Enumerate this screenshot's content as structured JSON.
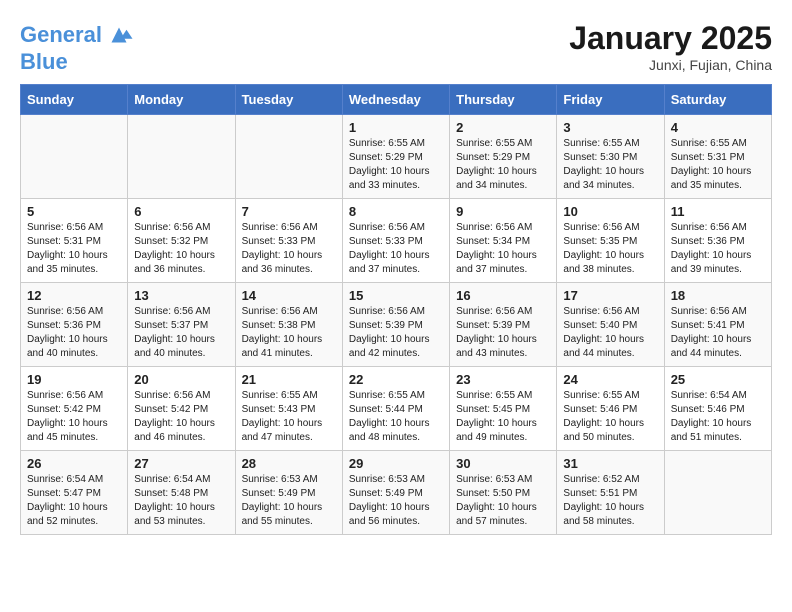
{
  "header": {
    "logo_line1": "General",
    "logo_line2": "Blue",
    "month": "January 2025",
    "location": "Junxi, Fujian, China"
  },
  "days_of_week": [
    "Sunday",
    "Monday",
    "Tuesday",
    "Wednesday",
    "Thursday",
    "Friday",
    "Saturday"
  ],
  "weeks": [
    [
      {
        "day": "",
        "info": ""
      },
      {
        "day": "",
        "info": ""
      },
      {
        "day": "",
        "info": ""
      },
      {
        "day": "1",
        "info": "Sunrise: 6:55 AM\nSunset: 5:29 PM\nDaylight: 10 hours\nand 33 minutes."
      },
      {
        "day": "2",
        "info": "Sunrise: 6:55 AM\nSunset: 5:29 PM\nDaylight: 10 hours\nand 34 minutes."
      },
      {
        "day": "3",
        "info": "Sunrise: 6:55 AM\nSunset: 5:30 PM\nDaylight: 10 hours\nand 34 minutes."
      },
      {
        "day": "4",
        "info": "Sunrise: 6:55 AM\nSunset: 5:31 PM\nDaylight: 10 hours\nand 35 minutes."
      }
    ],
    [
      {
        "day": "5",
        "info": "Sunrise: 6:56 AM\nSunset: 5:31 PM\nDaylight: 10 hours\nand 35 minutes."
      },
      {
        "day": "6",
        "info": "Sunrise: 6:56 AM\nSunset: 5:32 PM\nDaylight: 10 hours\nand 36 minutes."
      },
      {
        "day": "7",
        "info": "Sunrise: 6:56 AM\nSunset: 5:33 PM\nDaylight: 10 hours\nand 36 minutes."
      },
      {
        "day": "8",
        "info": "Sunrise: 6:56 AM\nSunset: 5:33 PM\nDaylight: 10 hours\nand 37 minutes."
      },
      {
        "day": "9",
        "info": "Sunrise: 6:56 AM\nSunset: 5:34 PM\nDaylight: 10 hours\nand 37 minutes."
      },
      {
        "day": "10",
        "info": "Sunrise: 6:56 AM\nSunset: 5:35 PM\nDaylight: 10 hours\nand 38 minutes."
      },
      {
        "day": "11",
        "info": "Sunrise: 6:56 AM\nSunset: 5:36 PM\nDaylight: 10 hours\nand 39 minutes."
      }
    ],
    [
      {
        "day": "12",
        "info": "Sunrise: 6:56 AM\nSunset: 5:36 PM\nDaylight: 10 hours\nand 40 minutes."
      },
      {
        "day": "13",
        "info": "Sunrise: 6:56 AM\nSunset: 5:37 PM\nDaylight: 10 hours\nand 40 minutes."
      },
      {
        "day": "14",
        "info": "Sunrise: 6:56 AM\nSunset: 5:38 PM\nDaylight: 10 hours\nand 41 minutes."
      },
      {
        "day": "15",
        "info": "Sunrise: 6:56 AM\nSunset: 5:39 PM\nDaylight: 10 hours\nand 42 minutes."
      },
      {
        "day": "16",
        "info": "Sunrise: 6:56 AM\nSunset: 5:39 PM\nDaylight: 10 hours\nand 43 minutes."
      },
      {
        "day": "17",
        "info": "Sunrise: 6:56 AM\nSunset: 5:40 PM\nDaylight: 10 hours\nand 44 minutes."
      },
      {
        "day": "18",
        "info": "Sunrise: 6:56 AM\nSunset: 5:41 PM\nDaylight: 10 hours\nand 44 minutes."
      }
    ],
    [
      {
        "day": "19",
        "info": "Sunrise: 6:56 AM\nSunset: 5:42 PM\nDaylight: 10 hours\nand 45 minutes."
      },
      {
        "day": "20",
        "info": "Sunrise: 6:56 AM\nSunset: 5:42 PM\nDaylight: 10 hours\nand 46 minutes."
      },
      {
        "day": "21",
        "info": "Sunrise: 6:55 AM\nSunset: 5:43 PM\nDaylight: 10 hours\nand 47 minutes."
      },
      {
        "day": "22",
        "info": "Sunrise: 6:55 AM\nSunset: 5:44 PM\nDaylight: 10 hours\nand 48 minutes."
      },
      {
        "day": "23",
        "info": "Sunrise: 6:55 AM\nSunset: 5:45 PM\nDaylight: 10 hours\nand 49 minutes."
      },
      {
        "day": "24",
        "info": "Sunrise: 6:55 AM\nSunset: 5:46 PM\nDaylight: 10 hours\nand 50 minutes."
      },
      {
        "day": "25",
        "info": "Sunrise: 6:54 AM\nSunset: 5:46 PM\nDaylight: 10 hours\nand 51 minutes."
      }
    ],
    [
      {
        "day": "26",
        "info": "Sunrise: 6:54 AM\nSunset: 5:47 PM\nDaylight: 10 hours\nand 52 minutes."
      },
      {
        "day": "27",
        "info": "Sunrise: 6:54 AM\nSunset: 5:48 PM\nDaylight: 10 hours\nand 53 minutes."
      },
      {
        "day": "28",
        "info": "Sunrise: 6:53 AM\nSunset: 5:49 PM\nDaylight: 10 hours\nand 55 minutes."
      },
      {
        "day": "29",
        "info": "Sunrise: 6:53 AM\nSunset: 5:49 PM\nDaylight: 10 hours\nand 56 minutes."
      },
      {
        "day": "30",
        "info": "Sunrise: 6:53 AM\nSunset: 5:50 PM\nDaylight: 10 hours\nand 57 minutes."
      },
      {
        "day": "31",
        "info": "Sunrise: 6:52 AM\nSunset: 5:51 PM\nDaylight: 10 hours\nand 58 minutes."
      },
      {
        "day": "",
        "info": ""
      }
    ]
  ]
}
